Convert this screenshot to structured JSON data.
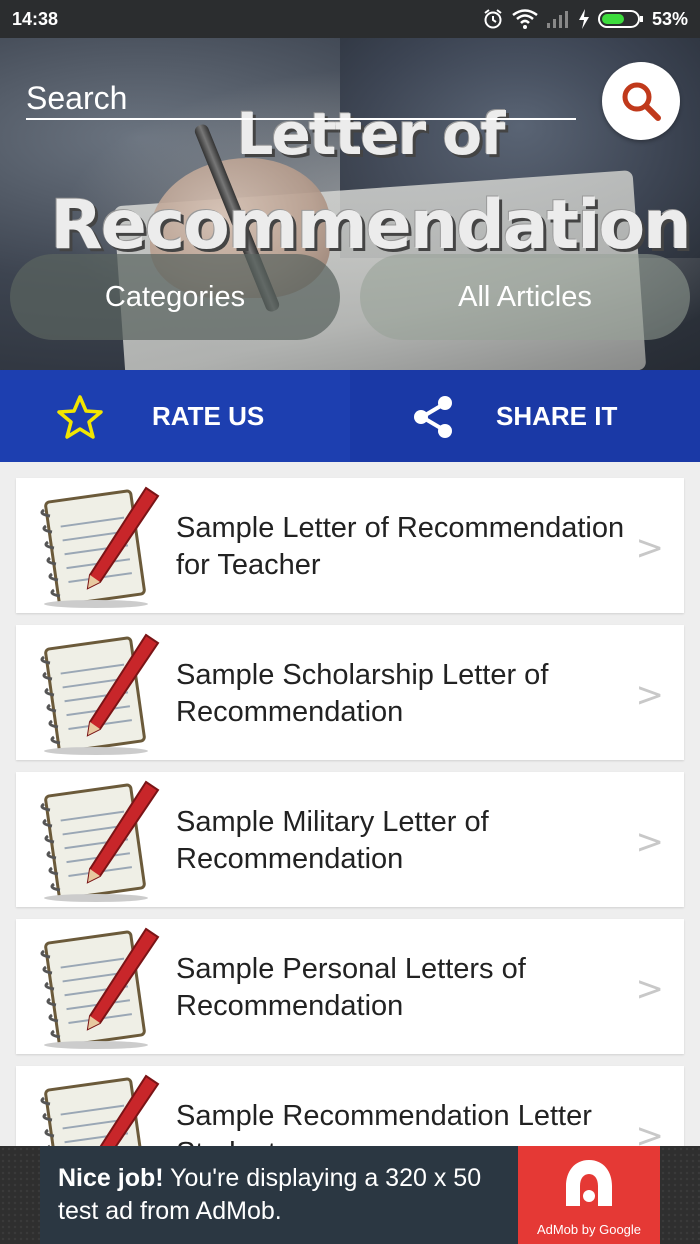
{
  "status_bar": {
    "time": "14:38",
    "battery_percent": "53%"
  },
  "header": {
    "search_placeholder": "Search",
    "title_line1": "Letter of",
    "title_line2": "Recommendation",
    "categories_label": "Categories",
    "all_articles_label": "All Articles"
  },
  "actions": {
    "rate_label": "RATE US",
    "share_label": "SHARE IT"
  },
  "articles": [
    {
      "title": "Sample Letter of Recommendation for Teacher",
      "chevron": ">"
    },
    {
      "title": "Sample Scholarship Letter of Recommendation",
      "chevron": ">"
    },
    {
      "title": "Sample Military Letter of Recommendation",
      "chevron": ">"
    },
    {
      "title": "Sample Personal Letters of Recommendation",
      "chevron": ">"
    },
    {
      "title": "Sample Recommendation Letter Student",
      "chevron": ">"
    }
  ],
  "ad": {
    "headline": "Nice job!",
    "body": " You're displaying a 320 x 50 test ad from AdMob.",
    "logo_label": "AdMob by Google"
  },
  "colors": {
    "action_bar": "#1d3fb0",
    "ad_red": "#e53935",
    "search_icon": "#c0391b"
  }
}
